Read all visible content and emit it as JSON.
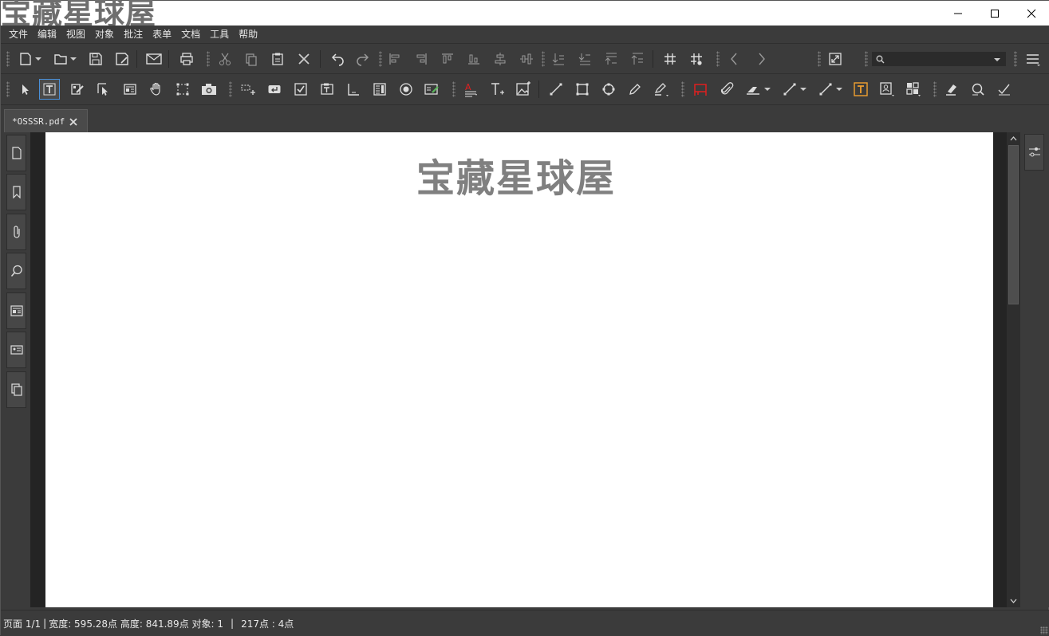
{
  "titlebar": {
    "watermark": "宝藏星球屋"
  },
  "menu": [
    "文件",
    "编辑",
    "视图",
    "对象",
    "批注",
    "表单",
    "文档",
    "工具",
    "帮助"
  ],
  "toolbar1": {
    "icons": [
      "new-document-icon",
      "open-folder-icon",
      "save-icon",
      "save-as-icon",
      "email-icon",
      "print-icon",
      "cut-icon",
      "copy-icon",
      "paste-icon",
      "delete-icon",
      "undo-icon",
      "redo-icon",
      "align-left-icon",
      "align-right-icon",
      "align-top-icon",
      "align-bottom-icon",
      "center-vertical-icon",
      "center-horizontal-icon",
      "distribute-1-icon",
      "distribute-2-icon",
      "distribute-3-icon",
      "distribute-4-icon",
      "grid-icon",
      "snap-grid-icon",
      "previous-icon",
      "next-icon",
      "fit-page-icon",
      "search-icon",
      "menu-icon"
    ],
    "search_placeholder": ""
  },
  "toolbar2": {
    "icons": [
      "select-tool-icon",
      "text-select-icon",
      "edit-form-icon",
      "select-object-icon",
      "form-icon",
      "hand-icon",
      "marquee-icon",
      "snapshot-icon",
      "link-icon",
      "return-icon",
      "checkbox-icon",
      "text-field-icon",
      "list-icon",
      "list-box-icon",
      "radio-icon",
      "signature-field-icon",
      "highlight-text-icon",
      "typewriter-icon",
      "image-icon",
      "line-icon",
      "rectangle-icon",
      "polygon-icon",
      "pencil-icon",
      "highlighter-icon",
      "stamp-icon",
      "attachment-icon",
      "eraser-icon",
      "arrow-line-icon",
      "distance-icon",
      "textbox-icon",
      "callout-icon",
      "shapes-icon",
      "clear-icon",
      "zoom-icon",
      "check-icon"
    ]
  },
  "tab": {
    "label": "*OSSSR.pdf"
  },
  "document": {
    "title": "宝藏星球屋"
  },
  "status": {
    "page": "页面 1/1",
    "size": "宽度: 595.28点 高度: 841.89点 对象: 1",
    "coords": "217点 : 4点"
  },
  "colors": {
    "accent": "#4a90d9",
    "background": "#3b3b3b",
    "page": "#ffffff",
    "stamp_red": "#e02020",
    "orange": "#f0a030"
  }
}
